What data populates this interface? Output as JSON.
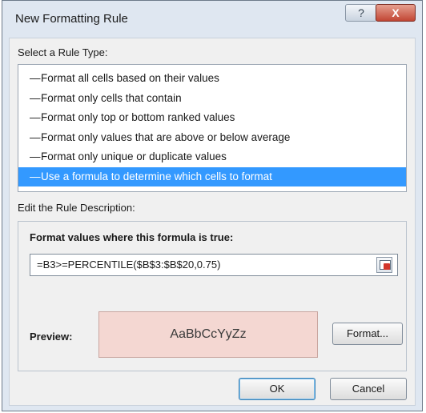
{
  "window": {
    "title": "New Formatting Rule",
    "help_glyph": "?",
    "close_glyph": "X"
  },
  "rule_type": {
    "label": "Select a Rule Type:",
    "items": [
      {
        "label": "Format all cells based on their values",
        "selected": false
      },
      {
        "label": "Format only cells that contain",
        "selected": false
      },
      {
        "label": "Format only top or bottom ranked values",
        "selected": false
      },
      {
        "label": "Format only values that are above or below average",
        "selected": false
      },
      {
        "label": "Format only unique or duplicate values",
        "selected": false
      },
      {
        "label": "Use a formula to determine which cells to format",
        "selected": true
      }
    ]
  },
  "description": {
    "label": "Edit the Rule Description:",
    "formula_label": "Format values where this formula is true:",
    "formula_value": "=B3>=PERCENTILE($B$3:$B$20,0.75)",
    "preview_label": "Preview:",
    "preview_text": "AaBbCcYyZz",
    "preview_fill": "#f4d7d2",
    "format_button": "Format..."
  },
  "footer": {
    "ok_label": "OK",
    "cancel_label": "Cancel"
  },
  "icons": {
    "list_bullet": "list-arrow-icon",
    "ref_button": "range-selector-icon"
  }
}
